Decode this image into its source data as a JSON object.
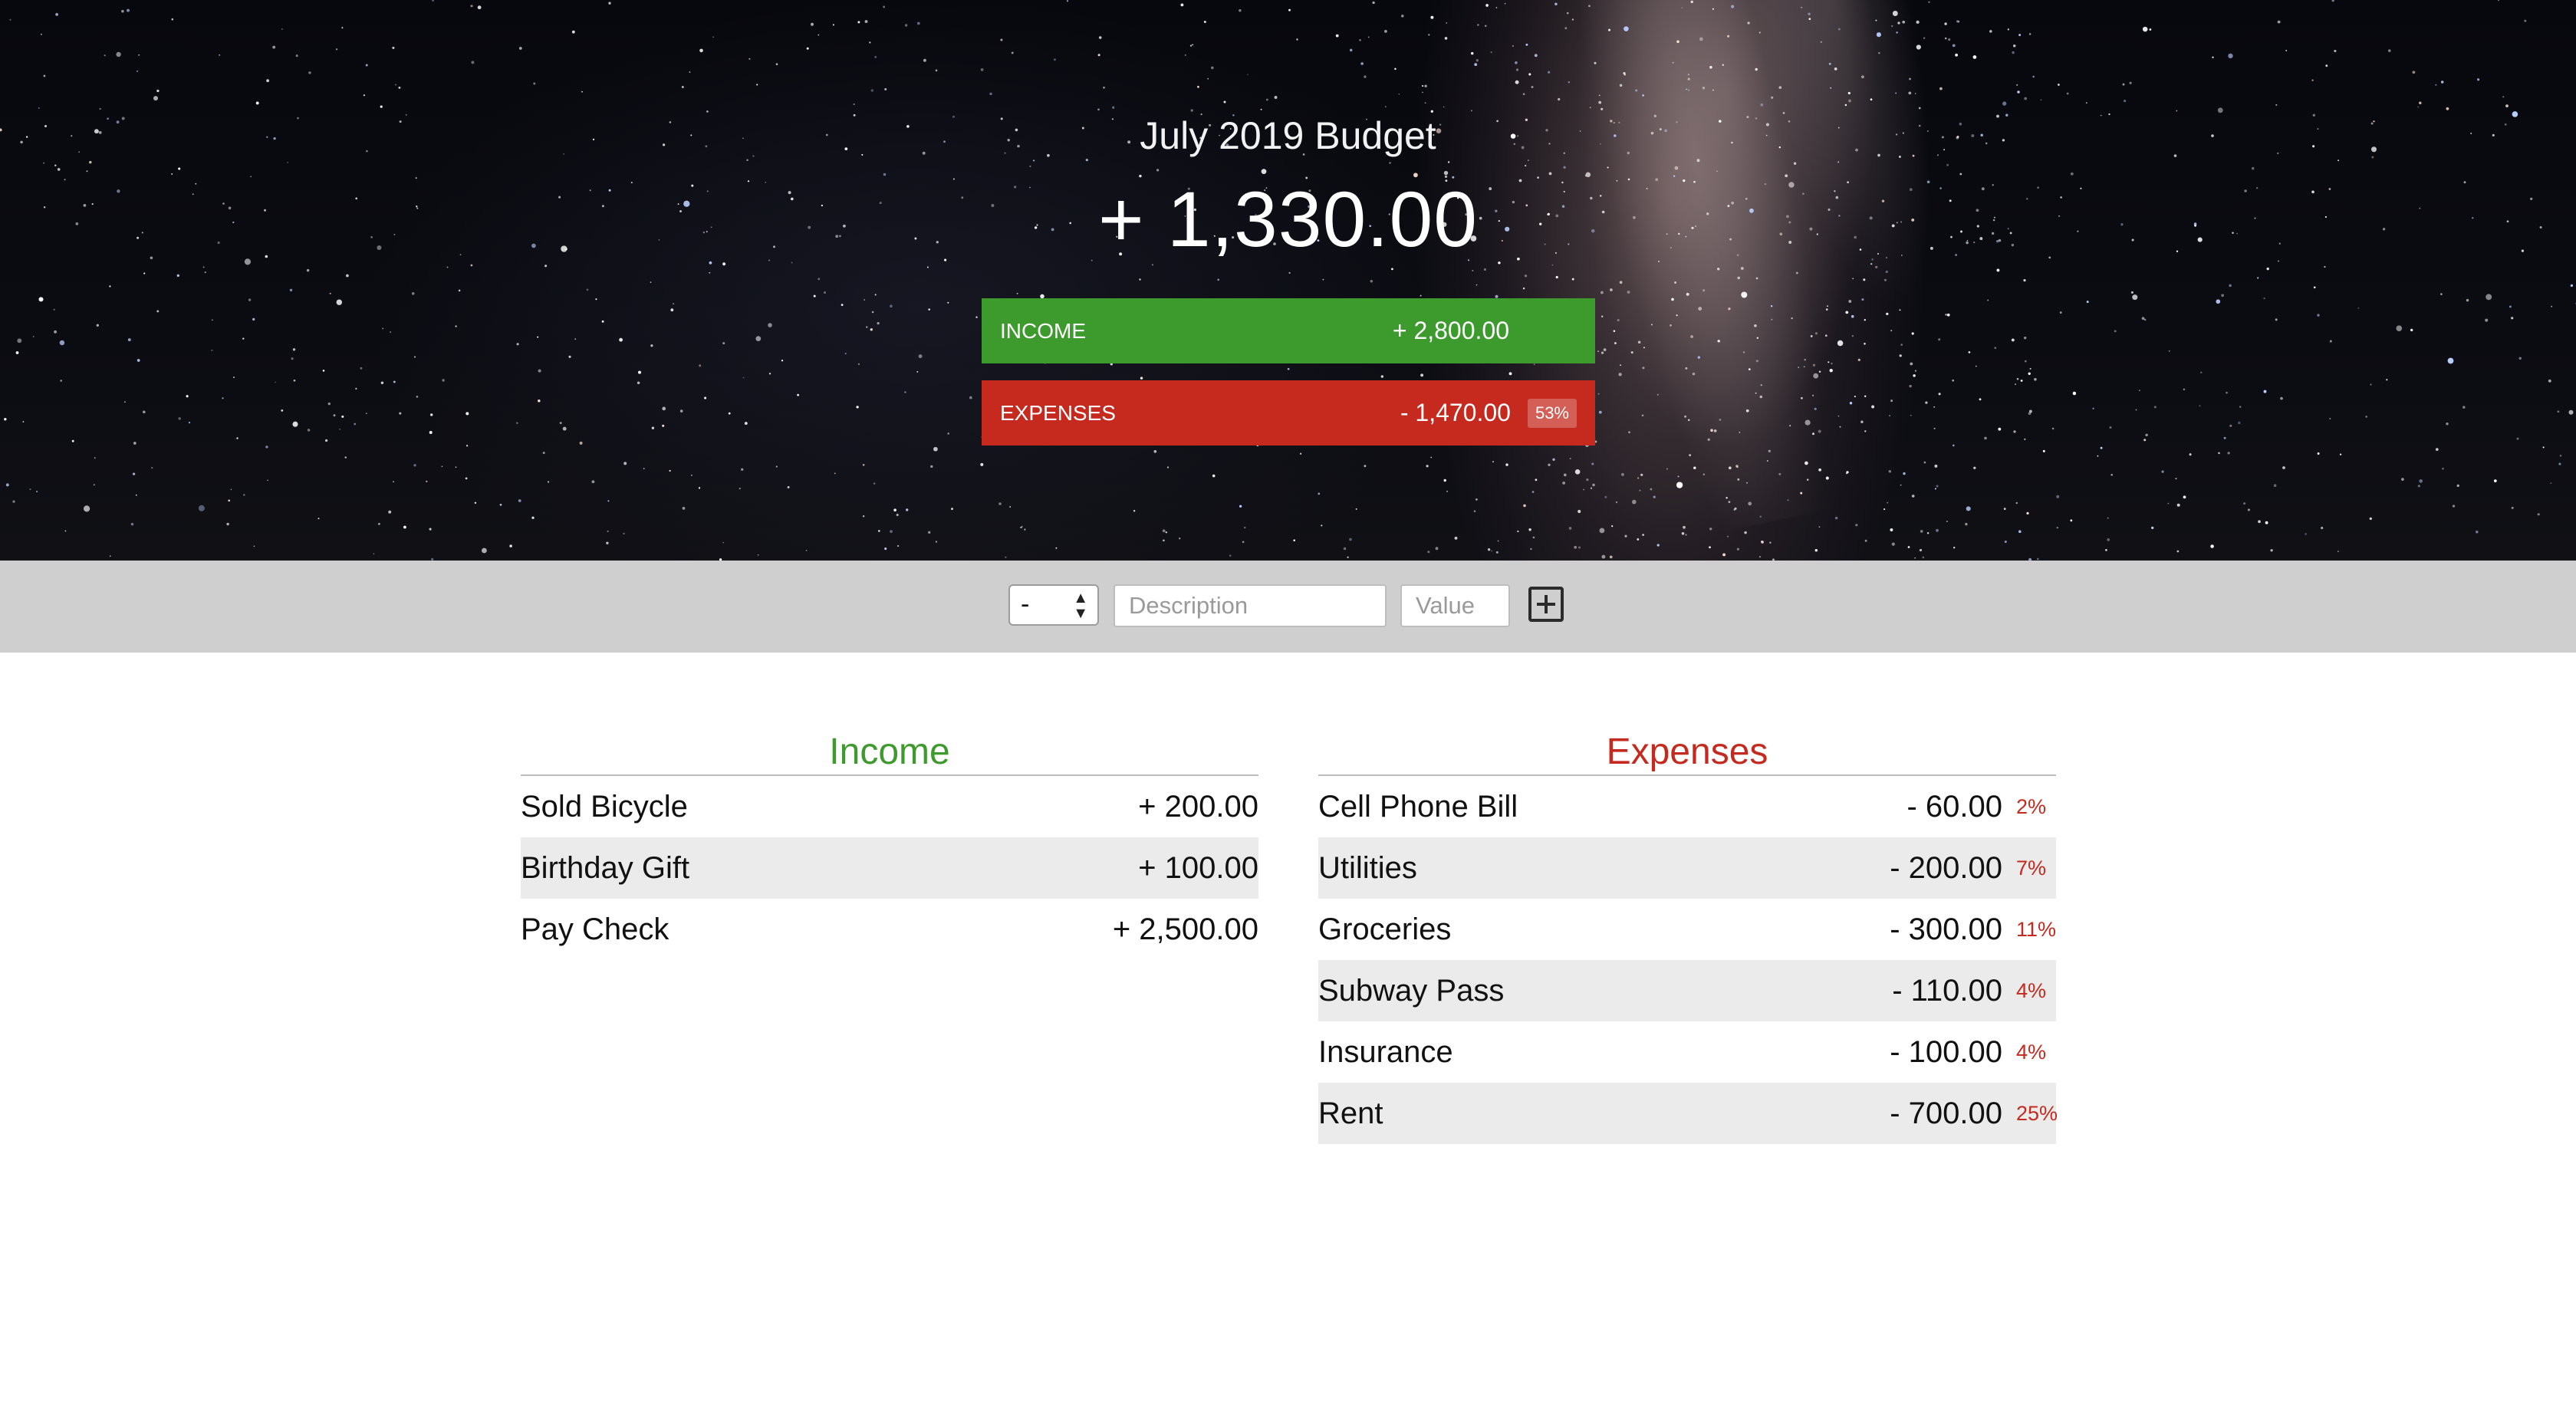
{
  "header": {
    "title": "July 2019 Budget",
    "total": "+ 1,330.00"
  },
  "summary": {
    "income": {
      "label": "INCOME",
      "value": "+ 2,800.00",
      "color": "#3d9a2c"
    },
    "expenses": {
      "label": "EXPENSES",
      "value": "- 1,470.00",
      "percentage": "53%",
      "color": "#c62a1f"
    }
  },
  "add_form": {
    "type_value": "-",
    "description_placeholder": "Description",
    "value_placeholder": "Value",
    "add_icon": "plus-square-icon"
  },
  "income_list": {
    "title": "Income",
    "items": [
      {
        "description": "Sold Bicycle",
        "value": "+ 200.00"
      },
      {
        "description": "Birthday Gift",
        "value": "+ 100.00"
      },
      {
        "description": "Pay Check",
        "value": "+ 2,500.00"
      }
    ]
  },
  "expenses_list": {
    "title": "Expenses",
    "items": [
      {
        "description": "Cell Phone Bill",
        "value": "- 60.00",
        "percentage": "2%"
      },
      {
        "description": "Utilities",
        "value": "- 200.00",
        "percentage": "7%"
      },
      {
        "description": "Groceries",
        "value": "- 300.00",
        "percentage": "11%"
      },
      {
        "description": "Subway Pass",
        "value": "- 110.00",
        "percentage": "4%"
      },
      {
        "description": "Insurance",
        "value": "- 100.00",
        "percentage": "4%"
      },
      {
        "description": "Rent",
        "value": "- 700.00",
        "percentage": "25%"
      }
    ]
  }
}
